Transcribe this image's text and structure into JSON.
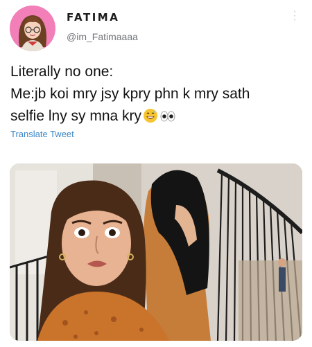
{
  "user": {
    "display_name": "FATIMA",
    "handle": "@im_Fatimaaaa",
    "avatar_color": "#f27fb8"
  },
  "tweet": {
    "lines": [
      "Literally no one:",
      "Me:jb koi mry jsy kpry phn k mry sath",
      "selfie lny sy mna kry"
    ],
    "translate_label": "Translate Tweet",
    "emojis": [
      "sweat-smile-emoji",
      "eyes-emoji"
    ]
  },
  "media": {
    "description_icon": "photo"
  },
  "colors": {
    "link": "#3b86c6",
    "text": "#111111",
    "secondary": "#6f7378"
  }
}
